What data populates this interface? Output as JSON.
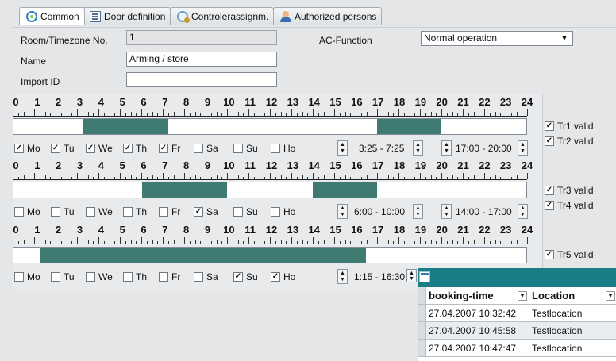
{
  "tabs": [
    {
      "label": "Common",
      "icon": "common-icon",
      "active": true
    },
    {
      "label": "Door definition",
      "icon": "door-icon",
      "active": false
    },
    {
      "label": "Controlerassignm.",
      "icon": "controller-icon",
      "active": false
    },
    {
      "label": "Authorized persons",
      "icon": "persons-icon",
      "active": false
    }
  ],
  "form": {
    "room_label": "Room/Timezone No.",
    "room_value": "1",
    "name_label": "Name",
    "name_value": "Arming / store",
    "import_label": "Import ID",
    "import_value": "",
    "ac_label": "AC-Function",
    "ac_value": "Normal operation"
  },
  "hours": [
    "0",
    "1",
    "2",
    "3",
    "4",
    "5",
    "6",
    "7",
    "8",
    "9",
    "10",
    "11",
    "12",
    "13",
    "14",
    "15",
    "16",
    "17",
    "18",
    "19",
    "20",
    "21",
    "22",
    "23",
    "24"
  ],
  "timelines": [
    {
      "segments": [
        [
          3.25,
          7.25
        ],
        [
          17.0,
          20.0
        ]
      ],
      "days": [
        {
          "label": "Mo",
          "checked": true
        },
        {
          "label": "Tu",
          "checked": true
        },
        {
          "label": "We",
          "checked": true
        },
        {
          "label": "Th",
          "checked": true
        },
        {
          "label": "Fr",
          "checked": true
        },
        {
          "label": "Sa",
          "checked": false
        },
        {
          "label": "Su",
          "checked": false
        },
        {
          "label": "Ho",
          "checked": false
        }
      ],
      "range1": "3:25 - 7:25",
      "range2": "17:00 - 20:00",
      "tr": [
        {
          "label": "Tr1 valid",
          "checked": true
        },
        {
          "label": "Tr2 valid",
          "checked": true
        }
      ]
    },
    {
      "segments": [
        [
          6.0,
          10.0
        ],
        [
          14.0,
          17.0
        ]
      ],
      "days": [
        {
          "label": "Mo",
          "checked": false
        },
        {
          "label": "Tu",
          "checked": false
        },
        {
          "label": "We",
          "checked": false
        },
        {
          "label": "Th",
          "checked": false
        },
        {
          "label": "Fr",
          "checked": false
        },
        {
          "label": "Sa",
          "checked": true
        },
        {
          "label": "Su",
          "checked": false
        },
        {
          "label": "Ho",
          "checked": false
        }
      ],
      "range1": "6:00 - 10:00",
      "range2": "14:00 - 17:00",
      "tr": [
        {
          "label": "Tr3 valid",
          "checked": true
        },
        {
          "label": "Tr4 valid",
          "checked": true
        }
      ]
    },
    {
      "segments": [
        [
          1.25,
          16.5
        ]
      ],
      "days": [
        {
          "label": "Mo",
          "checked": false
        },
        {
          "label": "Tu",
          "checked": false
        },
        {
          "label": "We",
          "checked": false
        },
        {
          "label": "Th",
          "checked": false
        },
        {
          "label": "Fr",
          "checked": false
        },
        {
          "label": "Sa",
          "checked": false
        },
        {
          "label": "Su",
          "checked": true
        },
        {
          "label": "Ho",
          "checked": true
        }
      ],
      "range1": "1:15 - 16:30",
      "tr": [
        {
          "label": "Tr5 valid",
          "checked": true
        }
      ]
    }
  ],
  "grid": {
    "columns": [
      "booking-time",
      "Location"
    ],
    "rows": [
      [
        "27.04.2007 10:32:42",
        "Testlocation"
      ],
      [
        "27.04.2007 10:45:58",
        "Testlocation"
      ],
      [
        "27.04.2007 10:47:47",
        "Testlocation"
      ]
    ]
  },
  "colors": {
    "segment": "#3f7a73",
    "grid_header": "#1a7d85"
  }
}
